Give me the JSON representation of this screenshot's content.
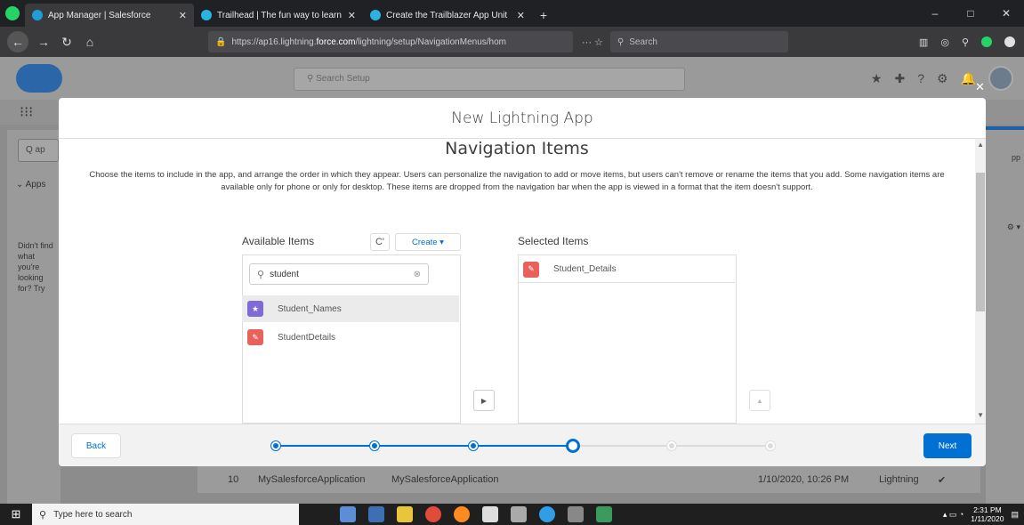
{
  "browser": {
    "tabs": [
      {
        "title": "App Manager | Salesforce",
        "favicon_color": "#1c9fd9",
        "active": true
      },
      {
        "title": "Trailhead | The fun way to learn",
        "favicon_color": "#2ab3e0",
        "active": false
      },
      {
        "title": "Create the Trailblazer App Unit",
        "favicon_color": "#2ab3e0",
        "active": false
      }
    ],
    "close_tab_glyph": "✕",
    "new_tab_glyph": "+",
    "window_controls": {
      "minimize": "–",
      "maximize": "□",
      "close": "✕"
    },
    "url_prefix": "https://ap16.lightning.",
    "url_domain": "force.com",
    "url_suffix": "/lightning/setup/NavigationMenus/hom",
    "url_more": "··· ☆",
    "search_placeholder": "Search"
  },
  "salesforce": {
    "search_placeholder": "Search Setup",
    "left_search": "Q ap",
    "apps_label": "Apps",
    "help_text": "Didn't find what you're looking for? Try",
    "right_frag_1": "pp",
    "right_frag_2": "⚙ ▾",
    "row": {
      "index": "10",
      "name": "MySalesforceApplication",
      "dev_name": "MySalesforceApplication",
      "date": "1/10/2020, 10:26 PM",
      "type": "Lightning",
      "check": "✔"
    }
  },
  "modal": {
    "title": "New Lightning App",
    "close_glyph": "✕",
    "step_title": "Navigation Items",
    "description": "Choose the items to include in the app, and arrange the order in which they appear. Users can personalize the navigation to add or move items, but users can't remove or rename the items that you add. Some navigation items are available only for phone or only for desktop. These items are dropped from the navigation bar when the app is viewed in a format that the item doesn't support.",
    "available_title": "Available Items",
    "refresh_glyph": "C'",
    "create_label": "Create ▾",
    "search_value": "student",
    "search_icon": "search-icon",
    "available_items": [
      {
        "label": "Student_Names",
        "icon_color": "#7f6bd3",
        "icon": "★",
        "selected": true
      },
      {
        "label": "StudentDetails",
        "icon_color": "#e8615a",
        "icon": "✎",
        "selected": false
      }
    ],
    "selected_title": "Selected Items",
    "selected_items": [
      {
        "label": "Student_Details",
        "icon_color": "#e8615a",
        "icon": "✎"
      }
    ],
    "move_right_glyph": "▶",
    "move_up_glyph": "▲",
    "back_label": "Back",
    "next_label": "Next",
    "progress_steps": 6,
    "progress_current": 4
  },
  "taskbar": {
    "search_placeholder": "Type here to search",
    "time": "2:31 PM",
    "date": "1/11/2020"
  }
}
